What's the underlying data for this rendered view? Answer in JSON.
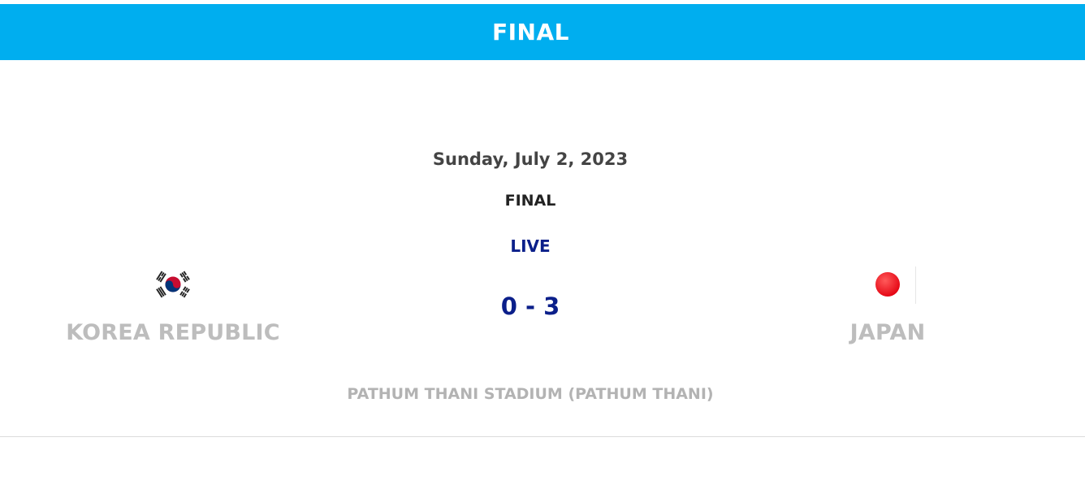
{
  "header": {
    "title": "FINAL",
    "background_color": "#00aeef"
  },
  "match": {
    "date": "Sunday, July 2, 2023",
    "stage": "FINAL",
    "status": "LIVE",
    "score": "0 - 3",
    "venue": "PATHUM THANI STADIUM (PATHUM THANI)",
    "home_team": {
      "name": "KOREA REPUBLIC",
      "flag_icon": "south-korea-flag-icon"
    },
    "away_team": {
      "name": "JAPAN",
      "flag_icon": "japan-flag-icon"
    }
  },
  "colors": {
    "score": "#0b1f8a",
    "team_name": "#bdbdbd",
    "venue": "#b3b3b3"
  }
}
